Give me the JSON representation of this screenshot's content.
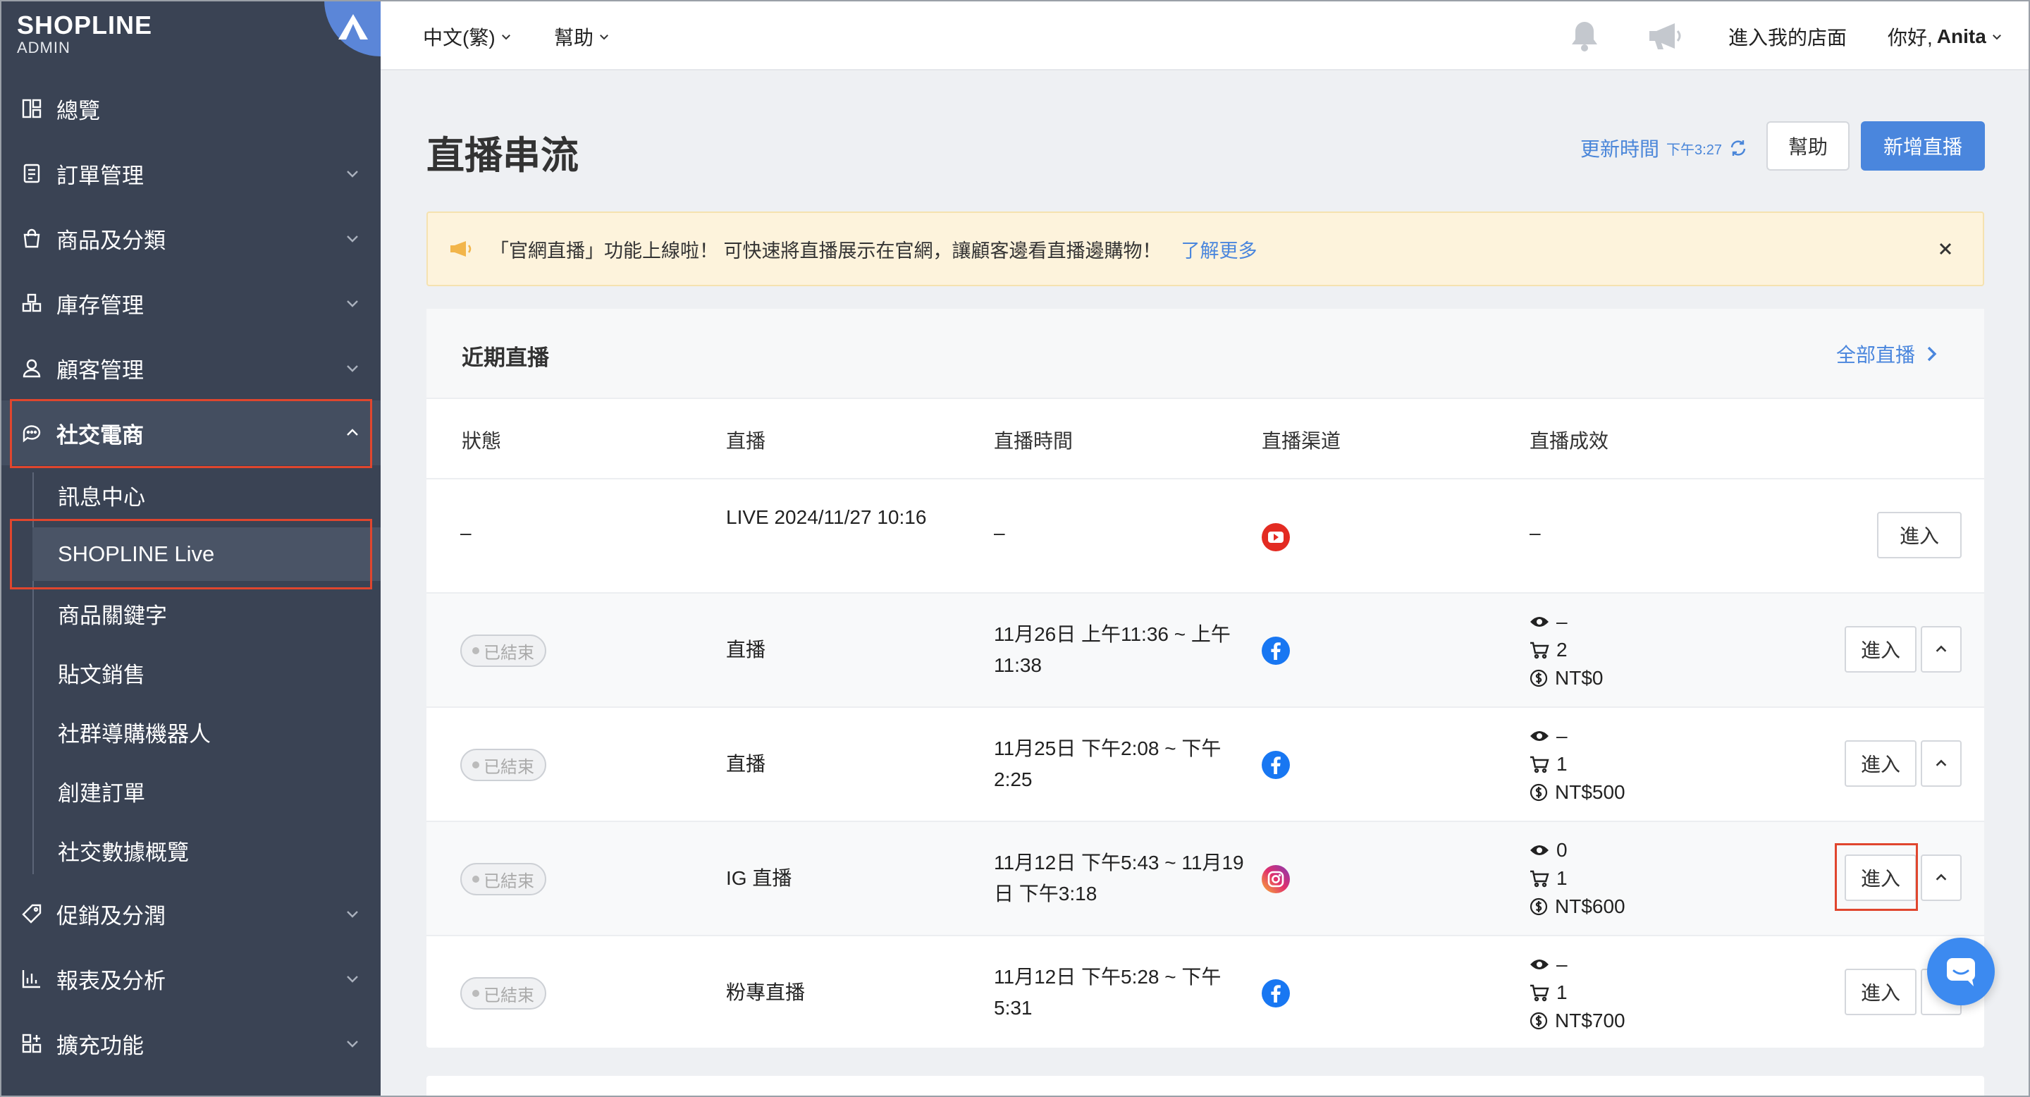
{
  "brand": {
    "name": "SHOPLINE",
    "sub": "ADMIN"
  },
  "sidebar": {
    "items": [
      {
        "label": "總覽"
      },
      {
        "label": "訂單管理"
      },
      {
        "label": "商品及分類"
      },
      {
        "label": "庫存管理"
      },
      {
        "label": "顧客管理"
      },
      {
        "label": "社交電商"
      },
      {
        "label": "促銷及分潤"
      },
      {
        "label": "報表及分析"
      },
      {
        "label": "擴充功能"
      }
    ],
    "sub_items": [
      {
        "label": "訊息中心"
      },
      {
        "label": "SHOPLINE Live"
      },
      {
        "label": "商品關鍵字"
      },
      {
        "label": "貼文銷售"
      },
      {
        "label": "社群導購機器人"
      },
      {
        "label": "創建訂單"
      },
      {
        "label": "社交數據概覽"
      }
    ]
  },
  "topbar": {
    "language": "中文(繁)",
    "help": "幫助",
    "store": "進入我的店面",
    "greeting": "你好, ",
    "user": "Anita"
  },
  "page": {
    "title": "直播串流",
    "update_label": "更新時間",
    "update_time": "下午3:27",
    "help_button": "幫助",
    "add_button": "新增直播"
  },
  "notice": {
    "text": "「官網直播」功能上線啦！ 可快速將直播展示在官網，讓顧客邊看直播邊購物！",
    "link": "了解更多"
  },
  "card": {
    "title": "近期直播",
    "all_link": "全部直播",
    "columns": [
      "狀態",
      "直播",
      "直播時間",
      "直播渠道",
      "直播成效"
    ],
    "ended_label": "已結束",
    "enter_label": "進入",
    "rows": [
      {
        "status": "–",
        "name": "LIVE 2024/11/27 10:16",
        "time": "–",
        "channel": "youtube",
        "result": "–"
      },
      {
        "status": "已結束",
        "name": "直播",
        "time": "11月26日 上午11:36 ~ 上午11:38",
        "channel": "facebook",
        "views": "–",
        "orders": "2",
        "sales": "NT$0"
      },
      {
        "status": "已結束",
        "name": "直播",
        "time": "11月25日 下午2:08 ~ 下午2:25",
        "channel": "facebook",
        "views": "–",
        "orders": "1",
        "sales": "NT$500"
      },
      {
        "status": "已結束",
        "name": "IG 直播",
        "time": "11月12日 下午5:43 ~ 11月19日 下午3:18",
        "channel": "instagram",
        "views": "0",
        "orders": "1",
        "sales": "NT$600"
      },
      {
        "status": "已結束",
        "name": "粉專直播",
        "time": "11月12日 下午5:28 ~ 下午5:31",
        "channel": "facebook",
        "views": "–",
        "orders": "1",
        "sales": "NT$700"
      }
    ]
  },
  "colors": {
    "sidebar": "#3a4354",
    "accent": "#4a86dd",
    "highlight": "#e0462e",
    "notice_bg": "#fdf3dc"
  }
}
